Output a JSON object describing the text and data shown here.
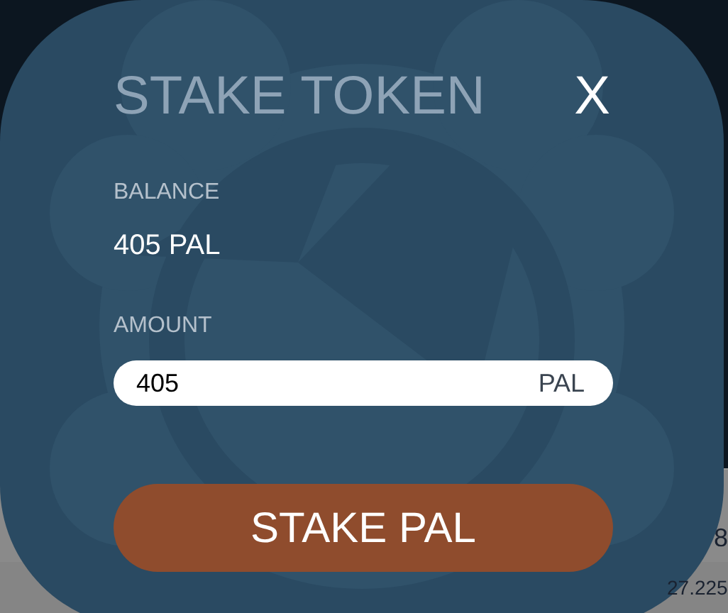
{
  "background_texts": [
    {
      "text": "8"
    },
    {
      "text": "27.225"
    }
  ],
  "dialog": {
    "title": "STAKE TOKEN",
    "close": "X",
    "balance": {
      "label": "BALANCE",
      "value": "405 PAL"
    },
    "amount": {
      "label": "AMOUNT",
      "value": "405",
      "unit": "PAL"
    },
    "button": "STAKE PAL"
  }
}
